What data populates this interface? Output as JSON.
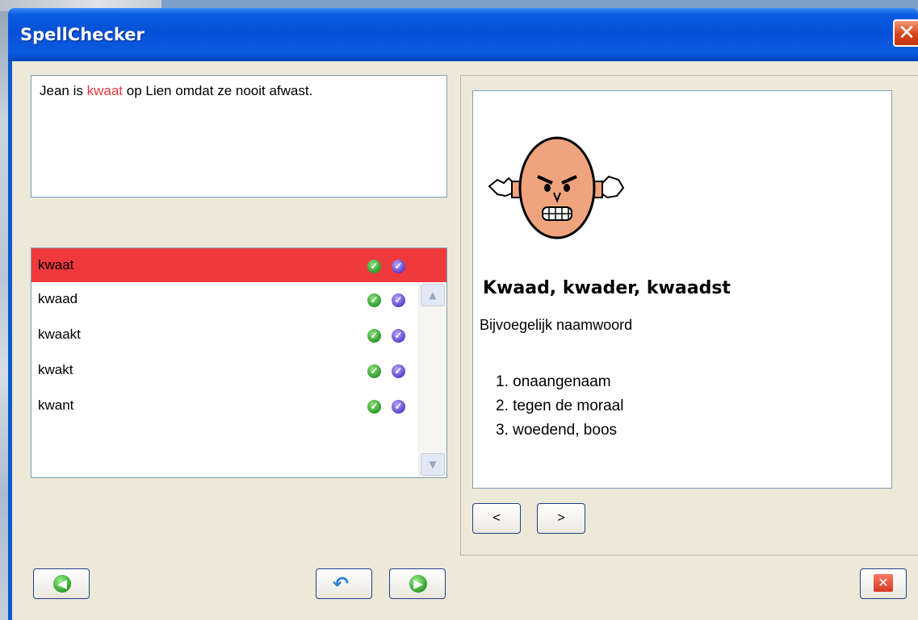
{
  "window": {
    "title": "SpellChecker",
    "close_glyph": "✕"
  },
  "source": {
    "before": "Jean is ",
    "mistake": "kwaat",
    "after": " op Lien omdat ze nooit afwast."
  },
  "suggestions": {
    "items": [
      {
        "label": "kwaat",
        "selected": true
      },
      {
        "label": "kwaad",
        "selected": false
      },
      {
        "label": "kwaakt",
        "selected": false
      },
      {
        "label": "kwakt",
        "selected": false
      },
      {
        "label": "kwant",
        "selected": false
      }
    ],
    "ok_icon": "green-check-icon",
    "speak_icon": "purple-check-icon",
    "scroll_up": "▲",
    "scroll_down": "▼"
  },
  "definition": {
    "title": "Kwaad, kwader, kwaadst",
    "word_type": "Bijvoegelijk naamwoord",
    "meanings": [
      "1. onaangenaam",
      "2. tegen de moraal",
      "3. woedend, boos"
    ],
    "picture": "angry-face-icon"
  },
  "nav": {
    "prev_label": "<",
    "next_label": ">"
  },
  "buttons": {
    "back_icon": "green-left-arrow-icon",
    "undo_icon": "undo-arrow-icon",
    "forward_icon": "green-right-arrow-icon",
    "close_icon": "red-close-icon",
    "back_glyph": "◀",
    "undo_glyph": "↶",
    "forward_glyph": "▶",
    "close_glyph": "✕"
  },
  "colors": {
    "mistake": "#e8393f",
    "selected_row": "#f0393c",
    "titlebar": "#0650d6",
    "client_bg": "#ece9d8"
  }
}
